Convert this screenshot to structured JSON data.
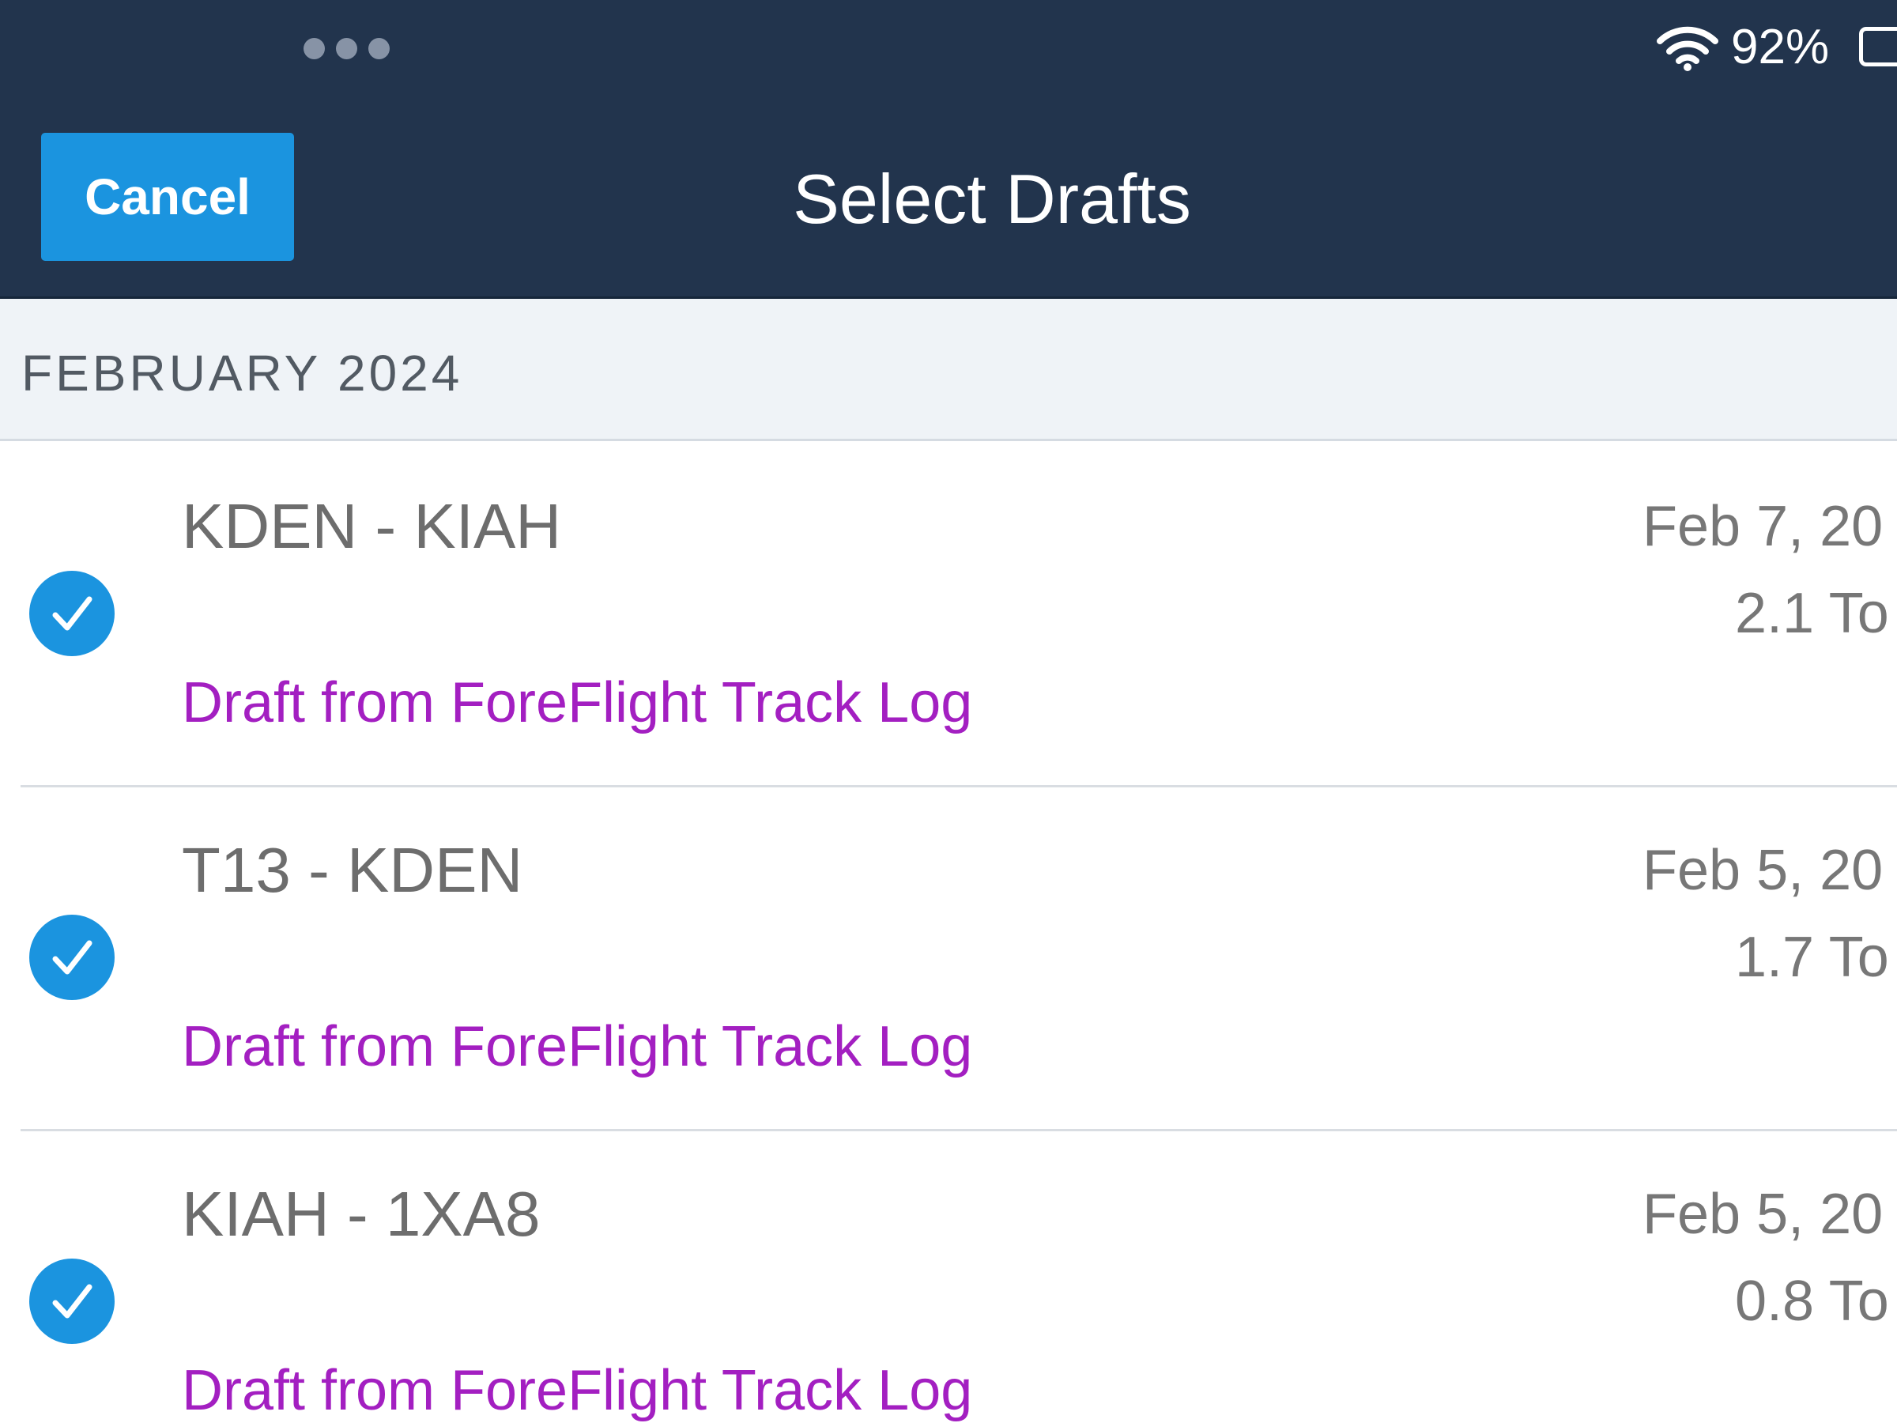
{
  "status_bar": {
    "battery_percent": "92%",
    "wifi_icon": "wifi-icon",
    "battery_icon": "battery-icon",
    "multitask_icon": "three-dots-icon"
  },
  "nav": {
    "cancel_label": "Cancel",
    "title": "Select Drafts"
  },
  "section": {
    "title": "FEBRUARY 2024"
  },
  "drafts": [
    {
      "route": "KDEN - KIAH",
      "subtitle": "Draft from ForeFlight Track Log",
      "date": "Feb 7, 20",
      "total": "2.1 To",
      "selected": true
    },
    {
      "route": "T13 - KDEN",
      "subtitle": "Draft from ForeFlight Track Log",
      "date": "Feb 5, 20",
      "total": "1.7 To",
      "selected": true
    },
    {
      "route": "KIAH - 1XA8",
      "subtitle": "Draft from ForeFlight Track Log",
      "date": "Feb 5, 20",
      "total": "0.8 To",
      "selected": true
    }
  ],
  "colors": {
    "header_bg": "#22344d",
    "accent_blue": "#1b94df",
    "subtitle_purple": "#a31fc1",
    "section_bg": "#eff3f7"
  }
}
